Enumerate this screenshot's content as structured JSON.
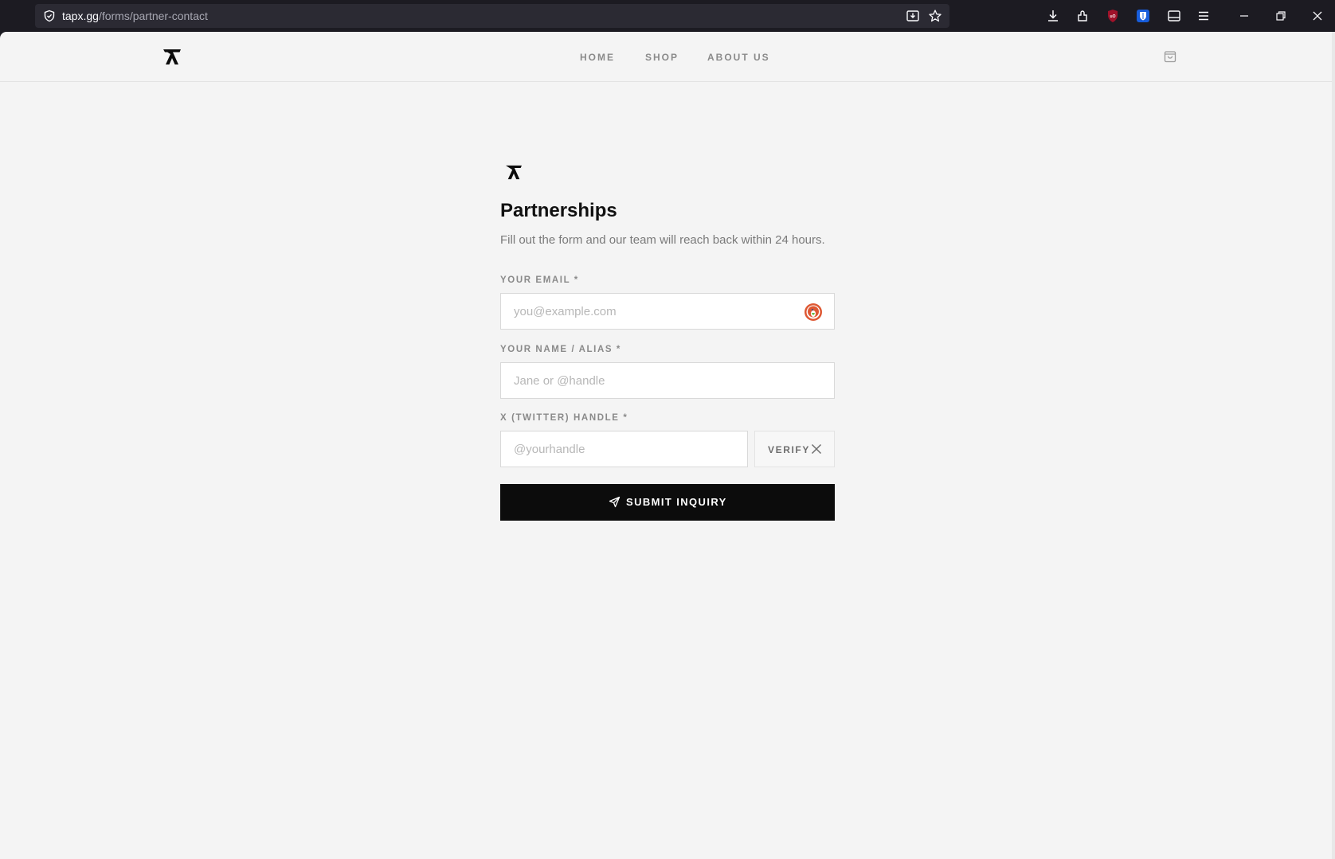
{
  "browser": {
    "url_host": "tapx.gg",
    "url_path": "/forms/partner-contact"
  },
  "nav": {
    "home": "HOME",
    "shop": "SHOP",
    "about": "ABOUT US"
  },
  "form": {
    "title": "Partnerships",
    "subtitle": "Fill out the form and our team will reach back within 24 hours.",
    "email_label": "YOUR EMAIL *",
    "email_placeholder": "you@example.com",
    "email_value": "",
    "name_label": "YOUR NAME / ALIAS *",
    "name_placeholder": "Jane or @handle",
    "name_value": "",
    "twitter_label": "X (TWITTER) HANDLE *",
    "twitter_placeholder": "@yourhandle",
    "twitter_value": "",
    "verify_label": "VERIFY",
    "submit_label": "SUBMIT INQUIRY"
  },
  "icons": {
    "shield": "shield-icon",
    "page_save": "page-save-icon",
    "bookmark": "star-icon",
    "downloads": "download-icon",
    "extensions": "puzzle-icon",
    "ublock": "ublock-icon",
    "bitwarden": "bitwarden-icon",
    "sidebar": "sidebar-icon",
    "menu": "hamburger-icon",
    "cart": "cart-icon",
    "duckduckgo": "duckduckgo-icon",
    "x_logo": "x-logo-icon",
    "send": "send-icon"
  },
  "colors": {
    "page_bg": "#f4f4f4",
    "button_bg": "#0c0c0c",
    "chrome_bg": "#1c1b22"
  }
}
